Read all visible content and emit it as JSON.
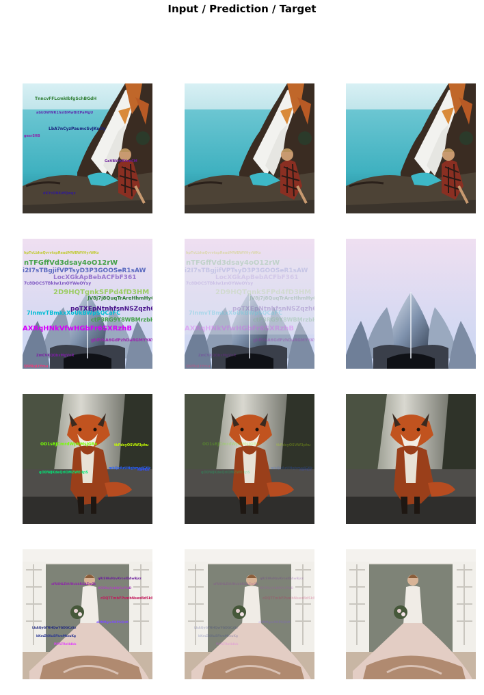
{
  "figure": {
    "title": "Input / Prediction / Target",
    "columns": [
      "Input",
      "Prediction",
      "Target"
    ]
  },
  "rows": [
    {
      "scene": "cliff-coast-person",
      "overlay_text": [
        "TnncvFFLcmkIbfgSchBGdH",
        "abkOWWR1hsIBMwBlEPaMgU",
        "LbA7nCyzPaumcSvJKuOy",
        "gesrSfiB"
      ]
    },
    {
      "scene": "lotus-temple",
      "overlay_text": [
        "hpTvLbhaQvrvtspReadMWBWYHyrWKo",
        "nTFGffVd3dsay4oO12rW",
        "i2I7sTBgjifVPTsyD3P3GOOSeR1sAW",
        "LocXGkApBebACFbF361",
        "7c8DOCSTBkIw1mOYWeOYsy",
        "2D9HQTgnkSFPd4fD3HM",
        "JV8j7j8QuqTrAreHhmHyGQ",
        "poTXEpNtnhfsnNSZqzh6u33yy",
        "7InmvTBmkxXoUkBWpSQCaFC",
        "ctP3RG9Y8WBMrzbHQNHQ",
        "AXRqHNkVfwHGbFr6SXRzhB",
        "gblfdsA6GdPzhDaRGMYYAYR"
      ]
    },
    {
      "scene": "red-fox",
      "overlay_text": [
        "OD1sBJCmrdWpVMsJGRv",
        "tkFdcyOSVW3phu",
        "mbQxAzUNqbmwlGKk",
        "Ra4kn",
        "qODWJKdeQrIOMZWEUpS"
      ]
    },
    {
      "scene": "bride-doorway",
      "overlay_text": [
        "sfRXNLEVtfNcbkRSAZmZt",
        "qRiSWuNzvKrcoIDAwBjsz",
        "XGYOqYnbWCsfYaD",
        "cDQTTmbFPsmbNsexBdSkBd",
        "sDNMgmVKPSQlrK",
        "LbAQyGTRHQwYGDGCzSz",
        "kKmZNXuSFkmMtzuKg",
        "PiPLTRzHdkb"
      ]
    }
  ]
}
